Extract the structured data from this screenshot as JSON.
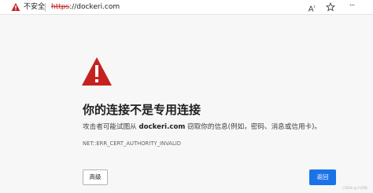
{
  "address_bar": {
    "security_label": "不安全",
    "url_scheme": "https",
    "url_rest": "://dockeri.com",
    "icons": [
      "warning-triangle-icon",
      "read-aloud-icon",
      "favorite-star-icon",
      "more-icon"
    ]
  },
  "error_page": {
    "heading": "你的连接不是专用连接",
    "message_prefix": "攻击者可能试图从 ",
    "message_host": "dockeri.com",
    "message_suffix": " 窃取你的信息(例如，密码、消息或信用卡)。",
    "error_code": "NET::ERR_CERT_AUTHORITY_INVALID",
    "advanced_label": "高级",
    "back_label": "返回",
    "icon": "warning-icon"
  },
  "watermark": "CSDN @人间有..",
  "colors": {
    "warning_red": "#c5221f",
    "primary_blue": "#1a73e8",
    "page_background": "#f7f7f7"
  }
}
